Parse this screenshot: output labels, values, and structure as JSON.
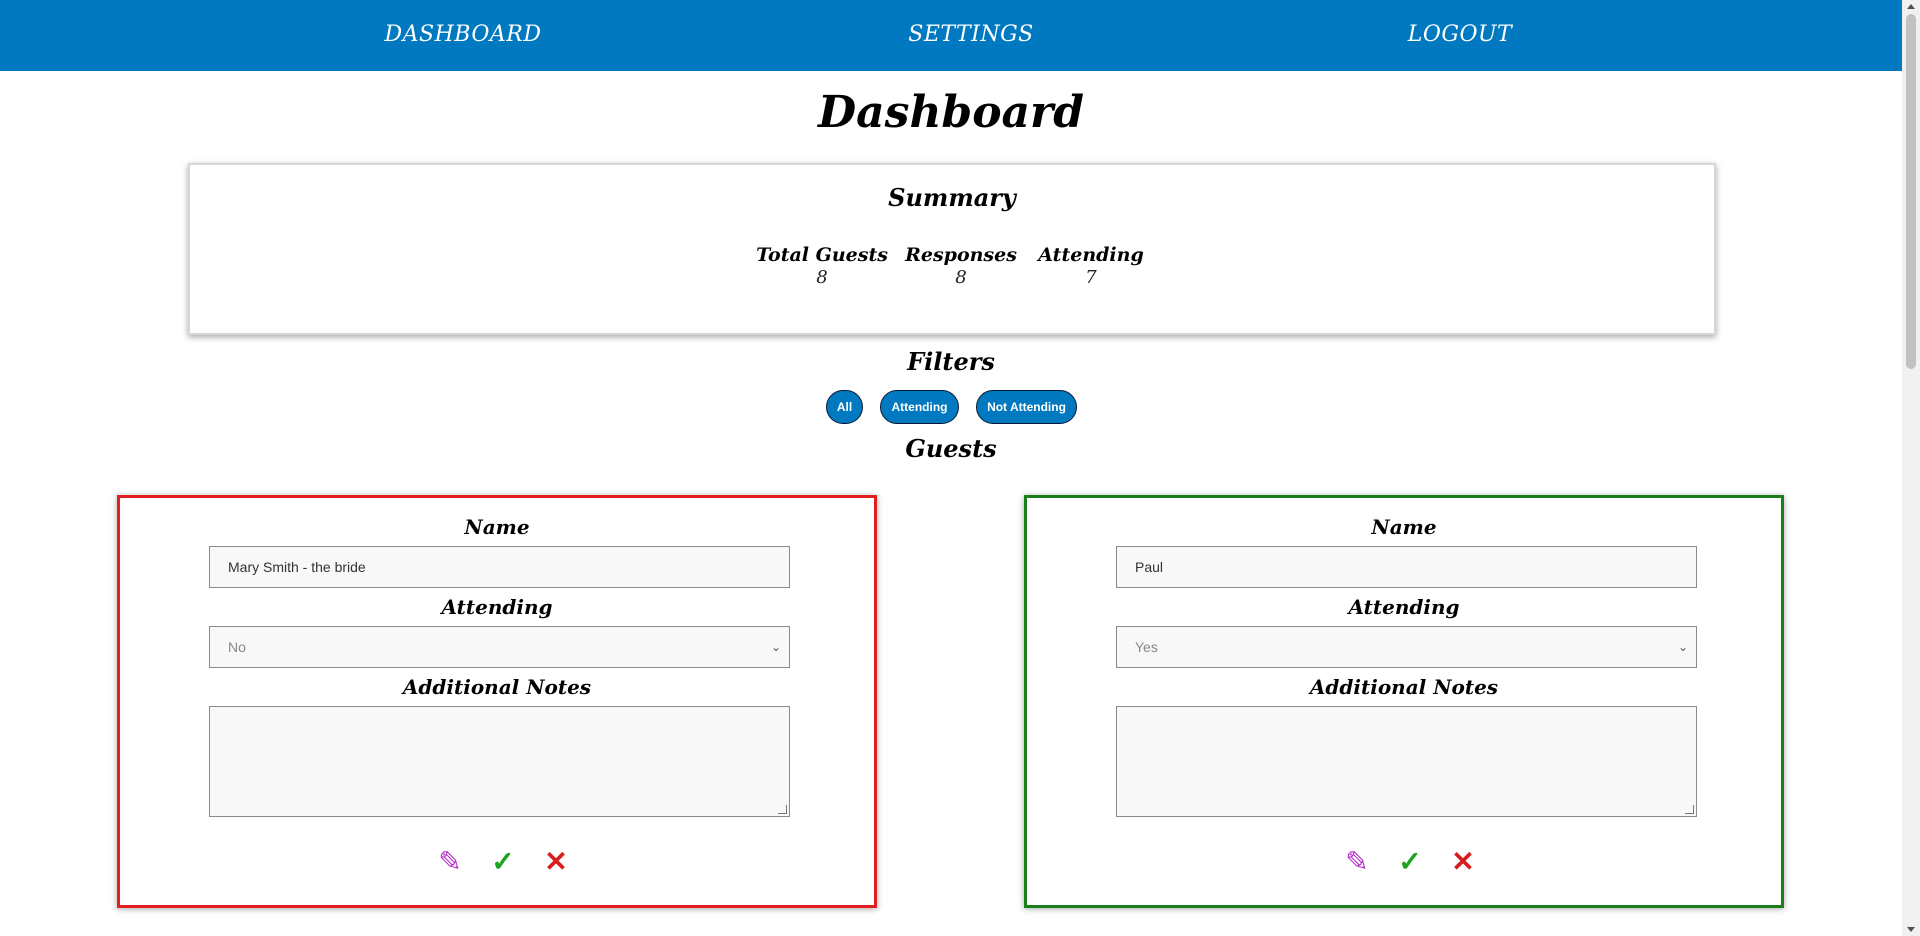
{
  "nav": {
    "links": [
      "DASHBOARD",
      "SETTINGS",
      "LOGOUT"
    ],
    "background": "#0079c1"
  },
  "page": {
    "title": "Dashboard"
  },
  "summary": {
    "title": "Summary",
    "stats": [
      {
        "label": "Total Guests",
        "value": "8"
      },
      {
        "label": "Responses",
        "value": "8"
      },
      {
        "label": "Attending",
        "value": "7"
      }
    ]
  },
  "filters": {
    "title": "Filters",
    "buttons": [
      "All",
      "Attending",
      "Not Attending"
    ]
  },
  "guests": {
    "title": "Guests",
    "cards": [
      {
        "name_label": "Name",
        "name_value": "Mary Smith - the bride",
        "attending_label": "Attending",
        "attending_value": "No",
        "notes_label": "Additional Notes",
        "notes_value": "",
        "border_color": "#e31e1e"
      },
      {
        "name_label": "Name",
        "name_value": "Paul",
        "attending_label": "Attending",
        "attending_value": "Yes",
        "notes_label": "Additional Notes",
        "notes_value": "",
        "border_color": "#1a7f1a"
      }
    ],
    "actions": {
      "edit_icon": "pencil-icon",
      "confirm_icon": "check-icon",
      "delete_icon": "close-icon"
    }
  }
}
